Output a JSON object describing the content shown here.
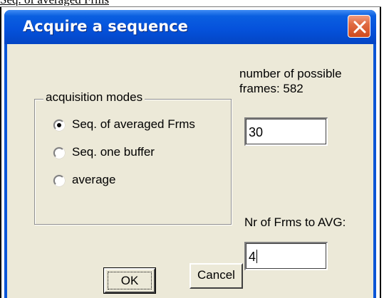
{
  "caption": "Seq. of averaged Frms",
  "dialog": {
    "title": "Acquire a sequence",
    "close_icon": "close-x-icon",
    "accent_color": "#0552dc",
    "close_color": "#cf4a1e"
  },
  "acquisition_modes": {
    "label": "acquisition modes",
    "options": [
      {
        "label": "Seq. of averaged Frms",
        "selected": true
      },
      {
        "label": "Seq. one buffer",
        "selected": false
      },
      {
        "label": "average",
        "selected": false
      }
    ]
  },
  "info": {
    "possible_frames_line1": "number of possible",
    "possible_frames_line2": "frames: 582"
  },
  "frames_field": {
    "value": "30"
  },
  "avg_field": {
    "label": "Nr of Frms to AVG:",
    "value": "4"
  },
  "buttons": {
    "ok": "OK",
    "cancel": "Cancel"
  }
}
